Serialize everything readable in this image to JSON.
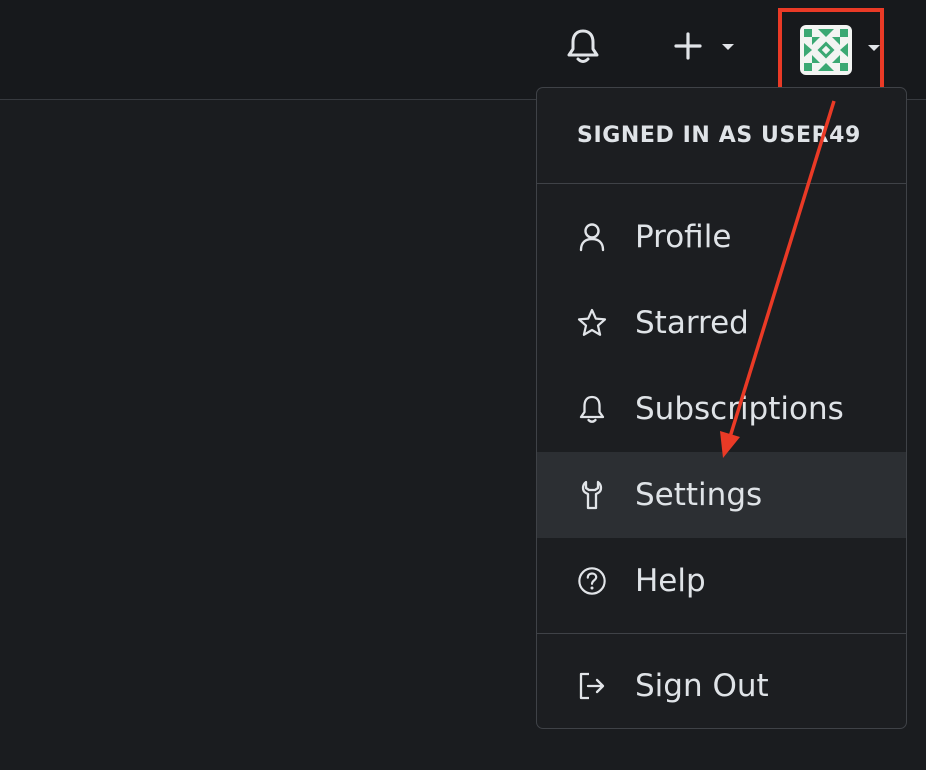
{
  "menu": {
    "header": "SIGNED IN AS USER49",
    "items": [
      {
        "label": "Profile",
        "icon": "person-icon"
      },
      {
        "label": "Starred",
        "icon": "star-icon"
      },
      {
        "label": "Subscriptions",
        "icon": "bell-icon"
      },
      {
        "label": "Settings",
        "icon": "tools-icon"
      },
      {
        "label": "Help",
        "icon": "question-icon"
      }
    ],
    "signout": {
      "label": "Sign Out",
      "icon": "sign-out-icon"
    }
  },
  "annotation": {
    "color": "#ea3a26"
  },
  "colors": {
    "background": "#1a1c1f",
    "menu_active": "#2c2f33",
    "avatar_green": "#3aa873"
  }
}
